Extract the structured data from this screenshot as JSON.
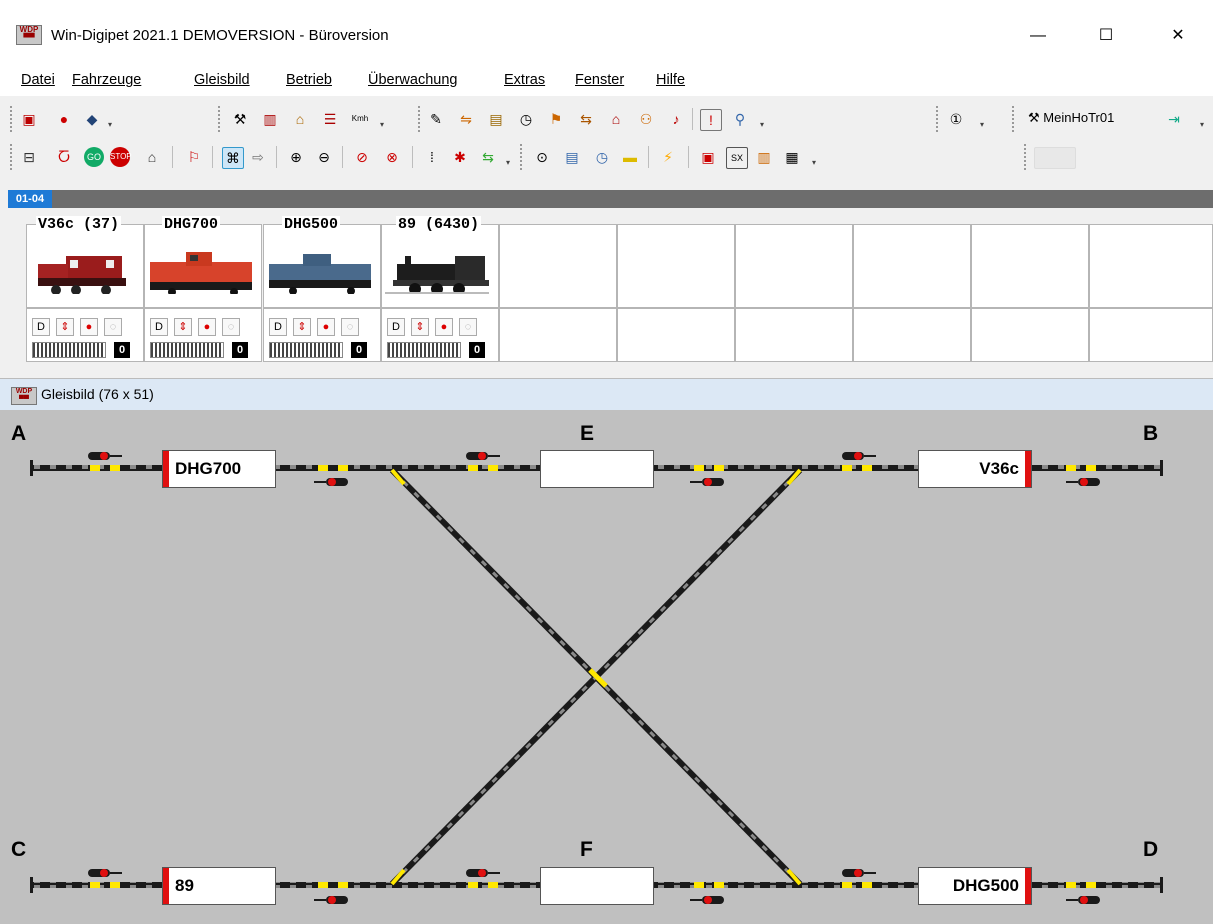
{
  "window": {
    "title": "Win-Digipet 2021.1 DEMOVERSION - Büroversion",
    "minimize": "—",
    "maximize": "☐",
    "close": "✕"
  },
  "menu": [
    "Datei",
    "Fahrzeuge",
    "Gleisbild",
    "Betrieb",
    "Überwachung",
    "Extras",
    "Fenster",
    "Hilfe"
  ],
  "toolbar1": {
    "profile_label": "MeinHoTr01",
    "counter_icon": "1-circle-icon"
  },
  "loco_panel": {
    "tab": "01-04",
    "locos": [
      {
        "name": "V36c (37)",
        "speed": "0",
        "color": "#8b1a1a"
      },
      {
        "name": "DHG700",
        "speed": "0",
        "color": "#d7432b"
      },
      {
        "name": "DHG500",
        "speed": "0",
        "color": "#4a6a8c"
      },
      {
        "name": "89 (6430)",
        "speed": "0",
        "color": "#222222"
      }
    ]
  },
  "gleisbild": {
    "title": "Gleisbild (76 x 51)",
    "corners": {
      "a": "A",
      "b": "B",
      "c": "C",
      "d": "D",
      "e": "E",
      "f": "F"
    },
    "blocks": {
      "ab_left": "DHG700",
      "ab_mid": "",
      "ab_right": "V36c",
      "cd_left": "89",
      "cd_mid": "",
      "cd_right": "DHG500"
    }
  },
  "colors": {
    "track": "#1a1a1a",
    "track_gray": "#8a8a8a",
    "yellow": "#ffe800",
    "signal_red": "#e01010",
    "canvas": "#c0c0c0"
  }
}
